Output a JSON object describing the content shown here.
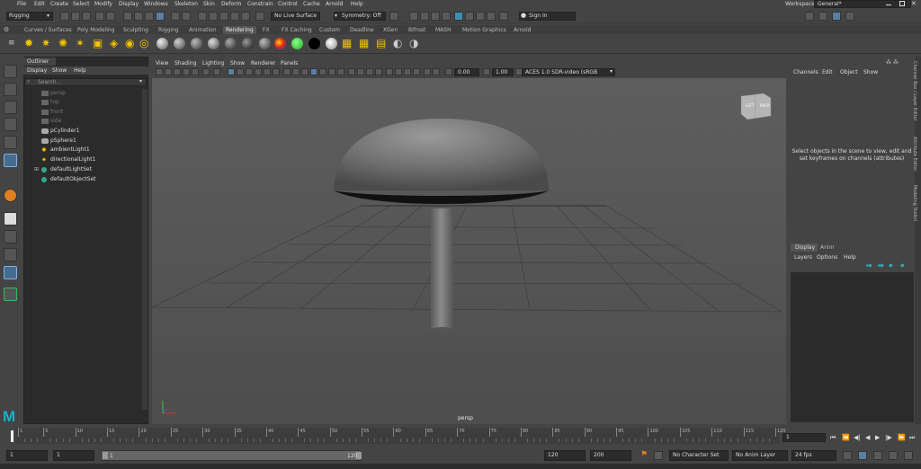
{
  "menubar": {
    "items": [
      "File",
      "Edit",
      "Create",
      "Select",
      "Modify",
      "Display",
      "Windows",
      "Skeleton",
      "Skin",
      "Deform",
      "Constrain",
      "Control",
      "Cache",
      "Arnold",
      "Help"
    ],
    "workspace_label": "Workspace:",
    "workspace_value": "General*"
  },
  "statusline": {
    "menuset": "Rigging",
    "live_surface": "No Live Surface",
    "symmetry": "Symmetry: Off",
    "sign_in": "Sign In"
  },
  "shelf": {
    "tabs": [
      "Curves / Surfaces",
      "Poly Modeling",
      "Sculpting",
      "Rigging",
      "Animation",
      "Rendering",
      "FX",
      "FX Caching",
      "Custom",
      "Deadline",
      "XGen",
      "Bifrost",
      "MASH",
      "Motion Graphics",
      "Arnold"
    ],
    "active_tab": "Rendering"
  },
  "outliner": {
    "title": "Outliner",
    "menu": [
      "Display",
      "Show",
      "Help"
    ],
    "search_placeholder": "Search...",
    "items": [
      {
        "label": "persp",
        "type": "camera",
        "dim": true
      },
      {
        "label": "top",
        "type": "camera",
        "dim": true
      },
      {
        "label": "front",
        "type": "camera",
        "dim": true
      },
      {
        "label": "side",
        "type": "camera",
        "dim": true
      },
      {
        "label": "pCylinder1",
        "type": "mesh",
        "dim": false
      },
      {
        "label": "pSphere1",
        "type": "mesh",
        "dim": false
      },
      {
        "label": "ambientLight1",
        "type": "light",
        "dim": false
      },
      {
        "label": "directionalLight1",
        "type": "light",
        "dim": false
      },
      {
        "label": "defaultLightSet",
        "type": "set",
        "dim": false
      },
      {
        "label": "defaultObjectSet",
        "type": "set",
        "dim": false
      }
    ]
  },
  "viewport": {
    "menu": [
      "View",
      "Shading",
      "Lighting",
      "Show",
      "Renderer",
      "Panels"
    ],
    "field_a": "0.00",
    "field_b": "1.00",
    "color_space": "ACES 1.0 SDR-video (sRGB",
    "camera_label": "persp",
    "viewcube_left": "LEFT",
    "viewcube_back": "BACK"
  },
  "channelbox": {
    "menu": [
      "Channels",
      "Edit",
      "Object",
      "Show"
    ],
    "message": "Select objects in the scene to view, edit and set keyframes on channels (attributes)"
  },
  "sidebar_tabs": [
    "Channel Box / Layer Editor",
    "Attribute Editor",
    "Modeling Toolkit"
  ],
  "layers": {
    "tabs": [
      "Display",
      "Anim"
    ],
    "menu": [
      "Layers",
      "Options",
      "Help"
    ]
  },
  "timeslider": {
    "tick_labels": [
      "1",
      "5",
      "10",
      "15",
      "20",
      "25",
      "30",
      "35",
      "40",
      "45",
      "50",
      "55",
      "60",
      "65",
      "70",
      "75",
      "80",
      "85",
      "90",
      "95",
      "100",
      "105",
      "110",
      "115",
      "120"
    ],
    "current_frame": "1"
  },
  "rangeslider": {
    "anim_start": "1",
    "playback_start": "1",
    "range_start_label": "1",
    "range_end_label": "120",
    "playback_end": "120",
    "anim_end": "200",
    "character_set": "No Character Set",
    "anim_layer": "No Anim Layer",
    "fps": "24 fps"
  },
  "logo": "M",
  "colors": {
    "accent": "#5a7fa3",
    "maya_logo": "#16b3c8",
    "panel_dark": "#2b2b2b",
    "ui_gray": "#444444"
  }
}
